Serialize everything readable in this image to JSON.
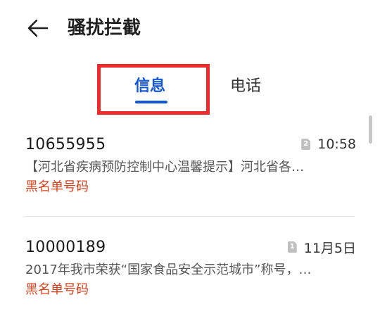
{
  "header": {
    "title": "骚扰拦截"
  },
  "tabs": [
    {
      "label": "信息",
      "active": true
    },
    {
      "label": "电话",
      "active": false
    }
  ],
  "messages": [
    {
      "sender": "10655955",
      "sim": "2",
      "time": "10:58",
      "preview": "【河北省疾病预防控制中心温馨提示】河北省各…",
      "tag": "黑名单号码"
    },
    {
      "sender": "10000189",
      "sim": "1",
      "time": "11月5日",
      "preview": "2017年我市荣获“国家食品安全示范城市”称号，…",
      "tag": "黑名单号码"
    }
  ],
  "colors": {
    "accent": "#1356d6",
    "tag": "#d9411e",
    "highlight": "#ef2a2a"
  }
}
